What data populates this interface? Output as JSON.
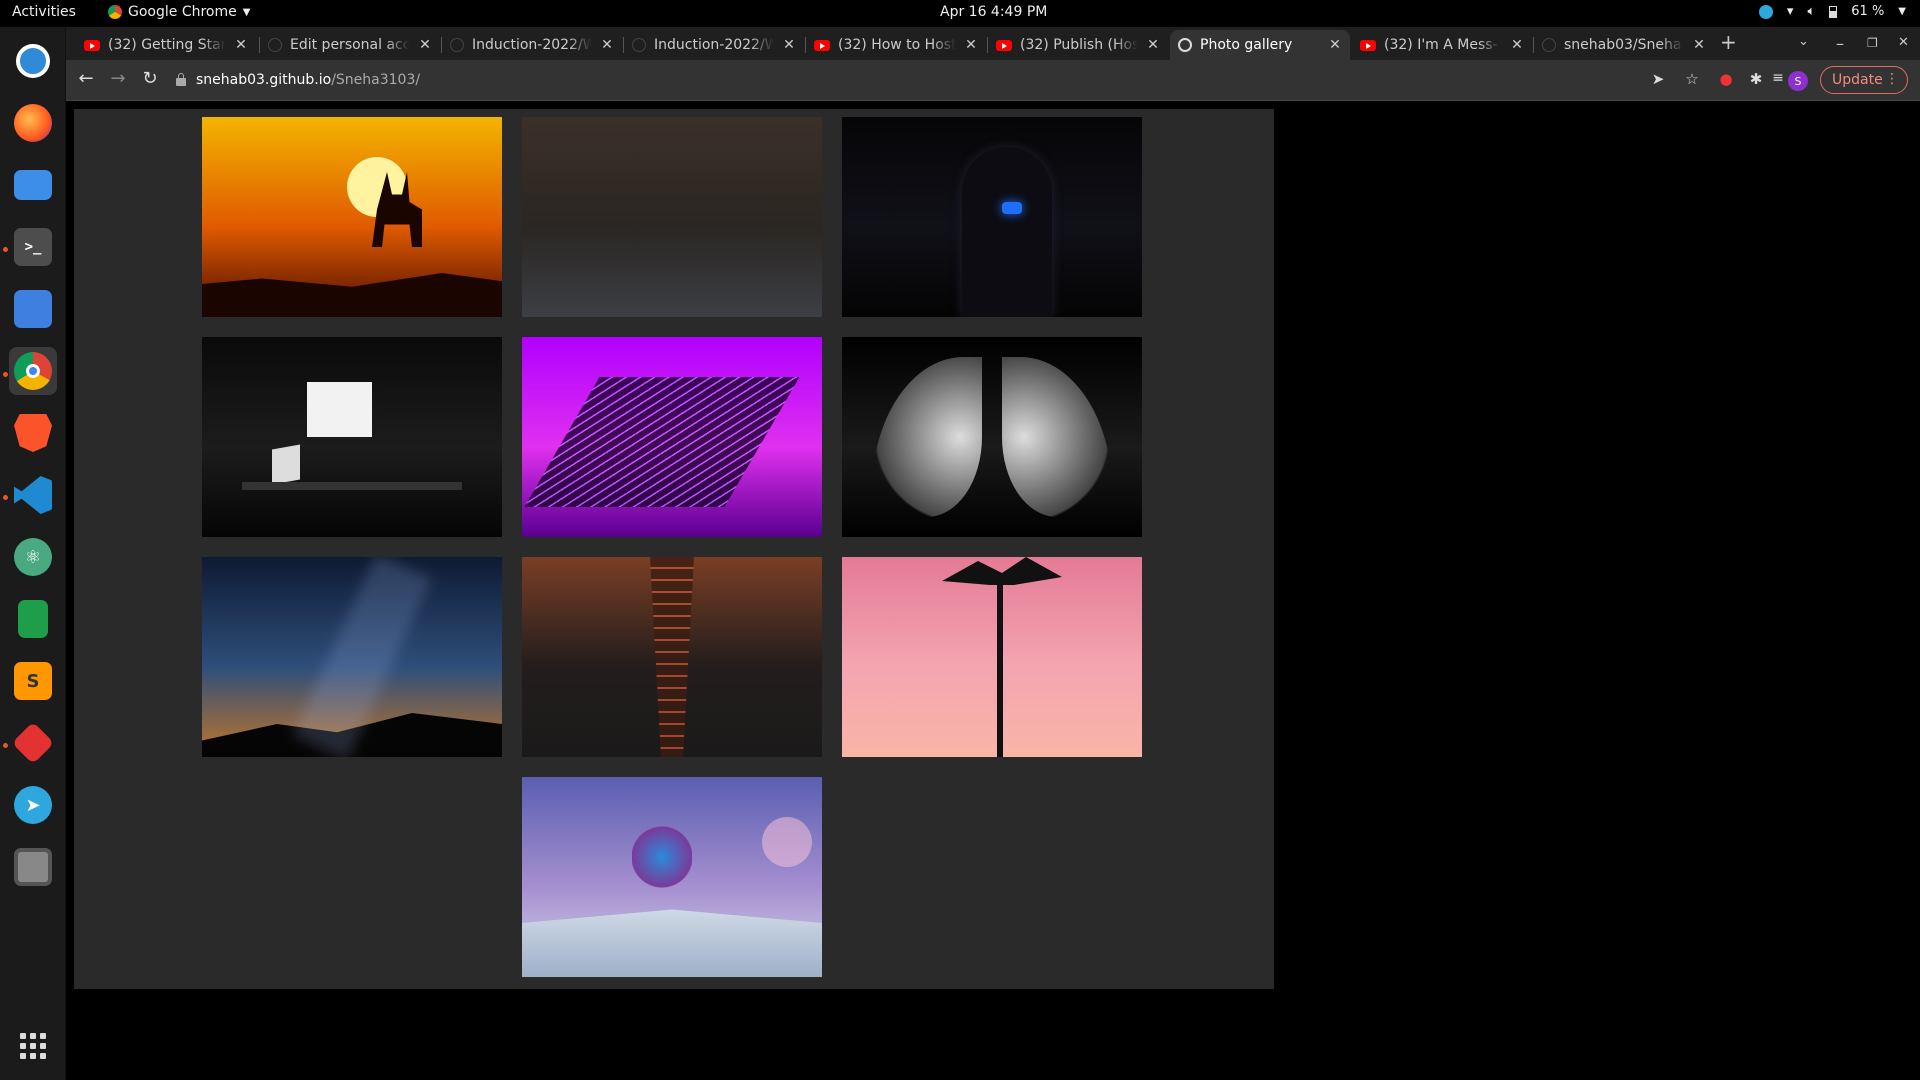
{
  "topbar": {
    "activities": "Activities",
    "app_name": "Google Chrome",
    "clock": "Apr 16  4:49 PM",
    "battery": "61 %"
  },
  "tabs": [
    {
      "title": "(32) Getting Start",
      "favicon": "youtube-icon"
    },
    {
      "title": "Edit personal acc",
      "favicon": "github-icon"
    },
    {
      "title": "Induction-2022/W",
      "favicon": "github-icon"
    },
    {
      "title": "Induction-2022/W",
      "favicon": "github-icon"
    },
    {
      "title": "(32) How to Host",
      "favicon": "youtube-icon"
    },
    {
      "title": "(32) Publish (Hos",
      "favicon": "youtube-icon"
    },
    {
      "title": "Photo gallery",
      "favicon": "globe-icon",
      "active": true
    },
    {
      "title": "(32) I'm A Mess- E",
      "favicon": "youtube-icon"
    },
    {
      "title": "snehab03/Sneha",
      "favicon": "github-icon"
    }
  ],
  "address": {
    "host": "snehab03.github.io",
    "path": "/Sneha3103/"
  },
  "toolbar": {
    "update_label": "Update",
    "avatar_letter": "S"
  },
  "dock": [
    "ubuntu-help-icon",
    "firefox-icon",
    "files-icon",
    "terminal-icon",
    "mail-icon",
    "chrome-icon",
    "brave-icon",
    "vscode-icon",
    "atom-icon",
    "sheets-icon",
    "sublime-icon",
    "git-icon",
    "telegram-icon",
    "disks-icon"
  ],
  "gallery": {
    "photos": [
      {
        "name": "deer-sunset-photo",
        "colors": [
          "#f3b400",
          "#e05a00",
          "#4a0d00"
        ]
      },
      {
        "name": "dark-road-photo",
        "colors": [
          "#3b3028",
          "#2a2622",
          "#3c3f44"
        ]
      },
      {
        "name": "hooded-figure-photo",
        "colors": [
          "#060608",
          "#101018",
          "#040404"
        ]
      },
      {
        "name": "desk-setup-photo",
        "colors": [
          "#0a0a0a",
          "#1c1c1c",
          "#050505"
        ]
      },
      {
        "name": "laptop-neon-photo",
        "colors": [
          "#b000ff",
          "#e030f0",
          "#5a0090"
        ]
      },
      {
        "name": "angel-wings-photo",
        "colors": [
          "#000000",
          "#1a1a1a",
          "#000000"
        ]
      },
      {
        "name": "milky-way-photo",
        "colors": [
          "#0e1a33",
          "#2e4e7a",
          "#c0762a"
        ]
      },
      {
        "name": "guitar-strings-photo",
        "colors": [
          "#7a3e25",
          "#231d1c",
          "#1a1a1a"
        ]
      },
      {
        "name": "palm-tree-pink-photo",
        "colors": [
          "#e47a96",
          "#f4a5b0",
          "#f9b5a8"
        ]
      },
      {
        "name": "book-flowers-photo",
        "colors": [
          "#5a5fb0",
          "#a58fd0",
          "#d0d8e8"
        ]
      }
    ]
  }
}
